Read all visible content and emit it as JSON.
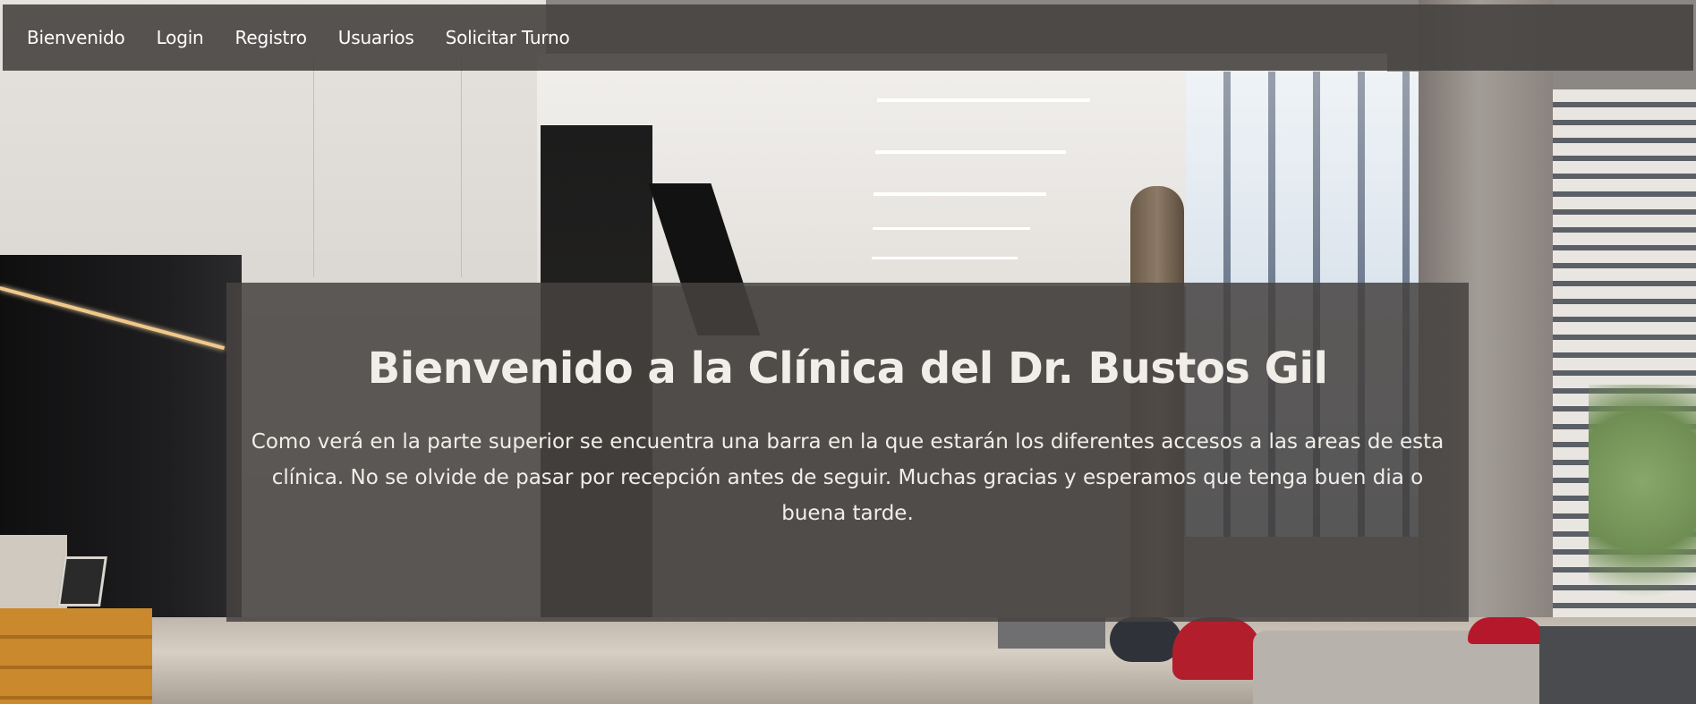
{
  "navbar": {
    "items": [
      {
        "label": "Bienvenido"
      },
      {
        "label": "Login"
      },
      {
        "label": "Registro"
      },
      {
        "label": "Usuarios"
      },
      {
        "label": "Solicitar Turno"
      }
    ]
  },
  "hero": {
    "title": "Bienvenido a la Clínica del Dr. Bustos Gil",
    "text": "Como verá en la parte superior se encuentra una barra en la que estarán los diferentes accesos a las areas de esta clínica. No se olvide de pasar por recepción antes de seguir. Muchas gracias y esperamos que tenga buen dia o buena tarde."
  },
  "colors": {
    "navbar_bg": "#464240",
    "panel_bg": "#464240",
    "text": "#f1eeea"
  }
}
